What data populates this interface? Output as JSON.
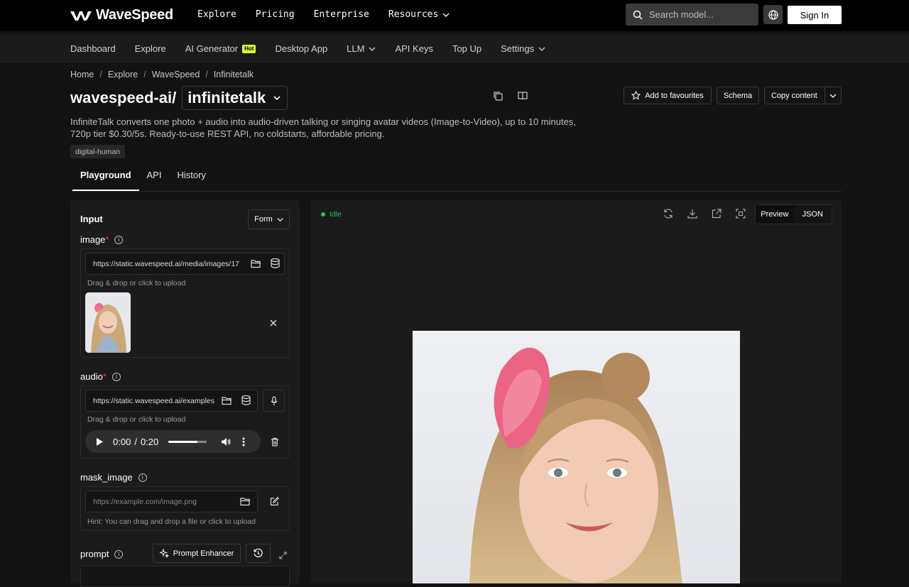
{
  "brand": {
    "name": "WaveSpeed"
  },
  "topnav": {
    "explore": "Explore",
    "pricing": "Pricing",
    "enterprise": "Enterprise",
    "resources": "Resources"
  },
  "search": {
    "placeholder": "Search model..."
  },
  "auth": {
    "sign_in": "Sign In"
  },
  "subnav": {
    "dashboard": "Dashboard",
    "explore": "Explore",
    "ai_generator": "AI Generator",
    "hot_badge": "Hot",
    "desktop_app": "Desktop App",
    "llm": "LLM",
    "api_keys": "API Keys",
    "top_up": "Top Up",
    "settings": "Settings"
  },
  "breadcrumb": {
    "items": [
      "Home",
      "Explore",
      "WaveSpeed",
      "Infinitetalk"
    ],
    "separator": "/"
  },
  "model": {
    "org": "wavespeed-ai/",
    "name": "infinitetalk",
    "description": "InfiniteTalk converts one photo + audio into audio-driven talking or singing avatar videos (Image-to-Video), up to 10 minutes, 720p tier $0.30/5s. Ready-to-use REST API, no coldstarts, affordable pricing.",
    "tag": "digital-human"
  },
  "actions": {
    "favourite": "Add to favourites",
    "schema": "Schema",
    "copy": "Copy content"
  },
  "tabs": {
    "playground": "Playground",
    "api": "API",
    "history": "History"
  },
  "input": {
    "title": "Input",
    "mode": "Form",
    "image": {
      "label": "image",
      "required": "*",
      "value": "https://static.wavespeed.ai/media/images/17",
      "hint": "Drag & drop or click to upload"
    },
    "audio": {
      "label": "audio",
      "required": "*",
      "value": "https://static.wavespeed.ai/examples",
      "hint": "Drag & drop or click to upload",
      "current_time": "0:00",
      "separator": "/",
      "duration": "0:20",
      "progress": 0.0,
      "volume": 0.75
    },
    "mask_image": {
      "label": "mask_image",
      "placeholder": "https://example.com/image.png",
      "hint": "Hint: You can drag and drop a file or click to upload"
    },
    "prompt": {
      "label": "prompt",
      "enhancer": "Prompt Enhancer"
    }
  },
  "output": {
    "status": "Idle",
    "view_preview": "Preview",
    "view_json": "JSON"
  },
  "colors": {
    "accent_hot": "#d4ff3a",
    "status_idle": "#22c55e",
    "required": "#ef4444"
  }
}
